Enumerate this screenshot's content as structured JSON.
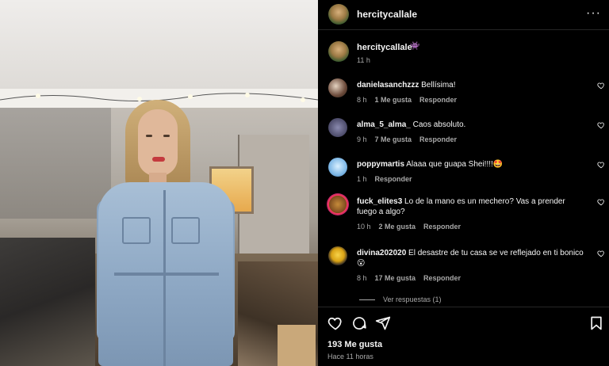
{
  "post": {
    "username": "hercitycallale",
    "more_label": "···",
    "caption_emoji": "👾",
    "caption_time": "11 h",
    "likes": "193 Me gusta",
    "posted_ago": "Hace 11 horas"
  },
  "comments": [
    {
      "username": "danielasanchzzz",
      "text": "Bellísima!",
      "time": "8 h",
      "likes": "1 Me gusta",
      "reply": "Responder"
    },
    {
      "username": "alma_5_alma_",
      "text": "Caos absoluto.",
      "time": "9 h",
      "likes": "7 Me gusta",
      "reply": "Responder"
    },
    {
      "username": "poppymartis",
      "text": "Alaaa que guapa Shei!!!!🤩",
      "time": "1 h",
      "likes": "",
      "reply": "Responder"
    },
    {
      "username": "fuck_elites3",
      "text": "Lo de la mano es un mechero? Vas a prender fuego a algo?",
      "time": "10 h",
      "likes": "2 Me gusta",
      "reply": "Responder"
    },
    {
      "username": "divina202020",
      "text": "El desastre de tu casa se ve reflejado en ti bonico 😮",
      "time": "8 h",
      "likes": "17 Me gusta",
      "reply": "Responder"
    }
  ],
  "view_replies": "Ver respuestas (1)",
  "icons": {
    "like": "heart-icon",
    "comment": "comment-icon",
    "share": "share-icon",
    "save": "bookmark-icon"
  }
}
